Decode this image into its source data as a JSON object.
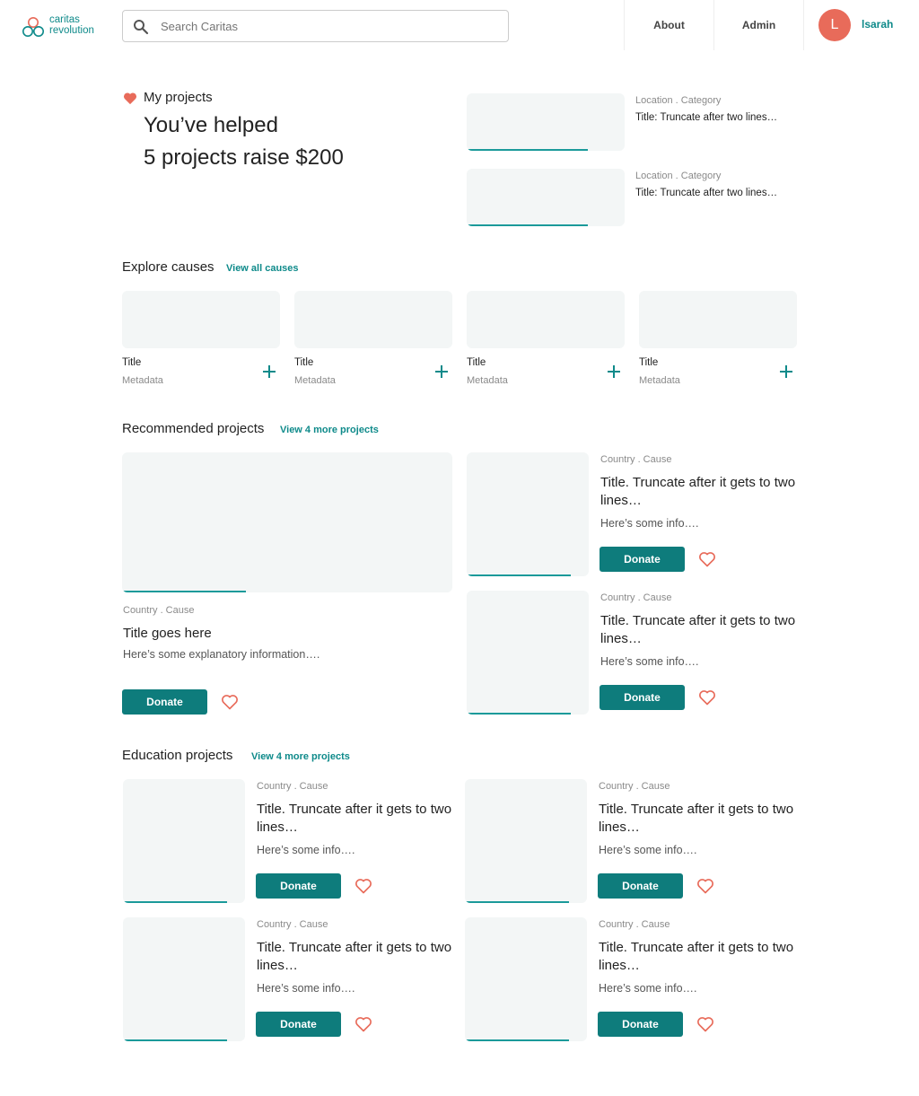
{
  "header": {
    "logo_line1": "caritas",
    "logo_line2": "revolution",
    "search_placeholder": "Search Caritas",
    "nav": [
      "About",
      "Admin"
    ],
    "avatar_initial": "L",
    "username": "lsarah"
  },
  "my_projects": {
    "label": "My projects",
    "line1": "You’ve helped",
    "line2": "5 projects raise $200",
    "items": [
      {
        "meta": "Location . Category",
        "title": "Title: Truncate after two lines…"
      },
      {
        "meta": "Location . Category",
        "title": "Title: Truncate after two lines…"
      }
    ]
  },
  "explore": {
    "heading": "Explore causes",
    "link": "View all causes",
    "cards": [
      {
        "title": "Title",
        "meta": "Metadata"
      },
      {
        "title": "Title",
        "meta": "Metadata"
      },
      {
        "title": "Title",
        "meta": "Metadata"
      },
      {
        "title": "Title",
        "meta": "Metadata"
      }
    ]
  },
  "recommended": {
    "heading": "Recommended projects",
    "link": "View 4 more projects",
    "featured": {
      "meta": "Country . Cause",
      "title": "Title goes here",
      "info": "Here’s some explanatory information….",
      "donate": "Donate"
    },
    "items": [
      {
        "meta": "Country . Cause",
        "title": "Title. Truncate after it gets to two lines…",
        "info": "Here’s some info….",
        "donate": "Donate"
      },
      {
        "meta": "Country . Cause",
        "title": "Title. Truncate after it gets to two lines…",
        "info": "Here’s some info….",
        "donate": "Donate"
      }
    ]
  },
  "education": {
    "heading": "Education projects",
    "link": "View 4 more projects",
    "items": [
      {
        "meta": "Country . Cause",
        "title": "Title. Truncate after it gets to two lines…",
        "info": "Here’s some info….",
        "donate": "Donate"
      },
      {
        "meta": "Country . Cause",
        "title": "Title. Truncate after it gets to two lines…",
        "info": "Here’s some info….",
        "donate": "Donate"
      },
      {
        "meta": "Country . Cause",
        "title": "Title. Truncate after it gets to two lines…",
        "info": "Here’s some info….",
        "donate": "Donate"
      },
      {
        "meta": "Country . Cause",
        "title": "Title. Truncate after it gets to two lines…",
        "info": "Here’s some info….",
        "donate": "Donate"
      }
    ]
  },
  "colors": {
    "accent": "#0e7c7c",
    "link": "#0e8a8a",
    "heart": "#e86b5a",
    "avatar": "#e86b5a",
    "placeholder": "#f3f6f6"
  }
}
